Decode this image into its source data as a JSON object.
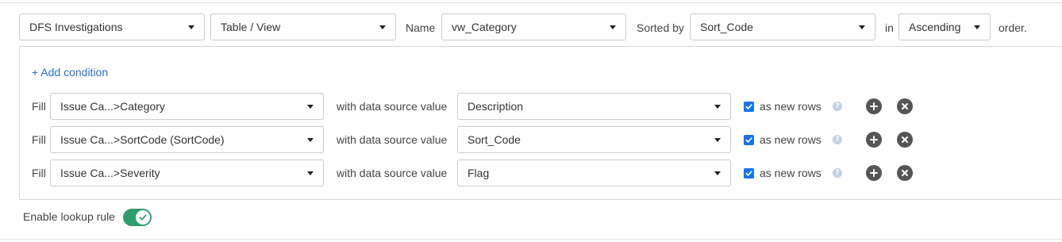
{
  "header": {
    "source": "DFS Investigations",
    "object_type": "Table / View",
    "name_label": "Name",
    "name_value": "vw_Category",
    "sorted_by_label": "Sorted by",
    "sort_field": "Sort_Code",
    "in_label": "in",
    "sort_order": "Ascending",
    "order_suffix": "order."
  },
  "add_condition": "+ Add condition",
  "rows": [
    {
      "fill_label": "Fill",
      "field": "Issue Ca...>Category",
      "with_label": "with data source value",
      "value": "Description",
      "as_new_rows_label": "as new rows",
      "as_new_rows": true
    },
    {
      "fill_label": "Fill",
      "field": "Issue Ca...>SortCode (SortCode)",
      "with_label": "with data source value",
      "value": "Sort_Code",
      "as_new_rows_label": "as new rows",
      "as_new_rows": true
    },
    {
      "fill_label": "Fill",
      "field": "Issue Ca...>Severity",
      "with_label": "with data source value",
      "value": "Flag",
      "as_new_rows_label": "as new rows",
      "as_new_rows": true
    }
  ],
  "help_glyph": "?",
  "lookup": {
    "label": "Enable lookup rule",
    "enabled": true
  },
  "colors": {
    "link": "#2a6fc9",
    "checkbox": "#1a73e8",
    "toggle_on": "#2e9d6f",
    "round_button": "#555555"
  },
  "icons": {
    "add": "plus-circle-icon",
    "remove": "x-circle-icon",
    "help": "question-circle-icon",
    "check": "check-icon",
    "caret": "chevron-down-icon"
  }
}
